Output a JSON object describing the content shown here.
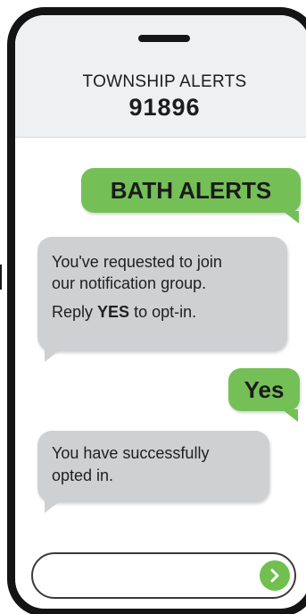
{
  "header": {
    "contact_name": "TOWNSHIP ALERTS",
    "contact_number": "91896"
  },
  "messages": [
    {
      "direction": "outgoing",
      "text": "BATH ALERTS"
    },
    {
      "direction": "incoming",
      "lines": [
        "You've requested to join",
        "our notification group."
      ],
      "reply_prefix": "Reply ",
      "reply_keyword": "YES",
      "reply_suffix": " to opt-in."
    },
    {
      "direction": "outgoing",
      "text": "Yes"
    },
    {
      "direction": "incoming",
      "lines": [
        "You have successfully",
        "opted in."
      ]
    }
  ],
  "composer": {
    "value": "",
    "send_icon": "chevron-right-circle-icon"
  },
  "colors": {
    "outgoing_bubble": "#74c057",
    "incoming_bubble": "#cfd0d2",
    "header_bg": "#eef0f1",
    "send_button": "#70bf4f",
    "phone_frame": "#141414"
  }
}
